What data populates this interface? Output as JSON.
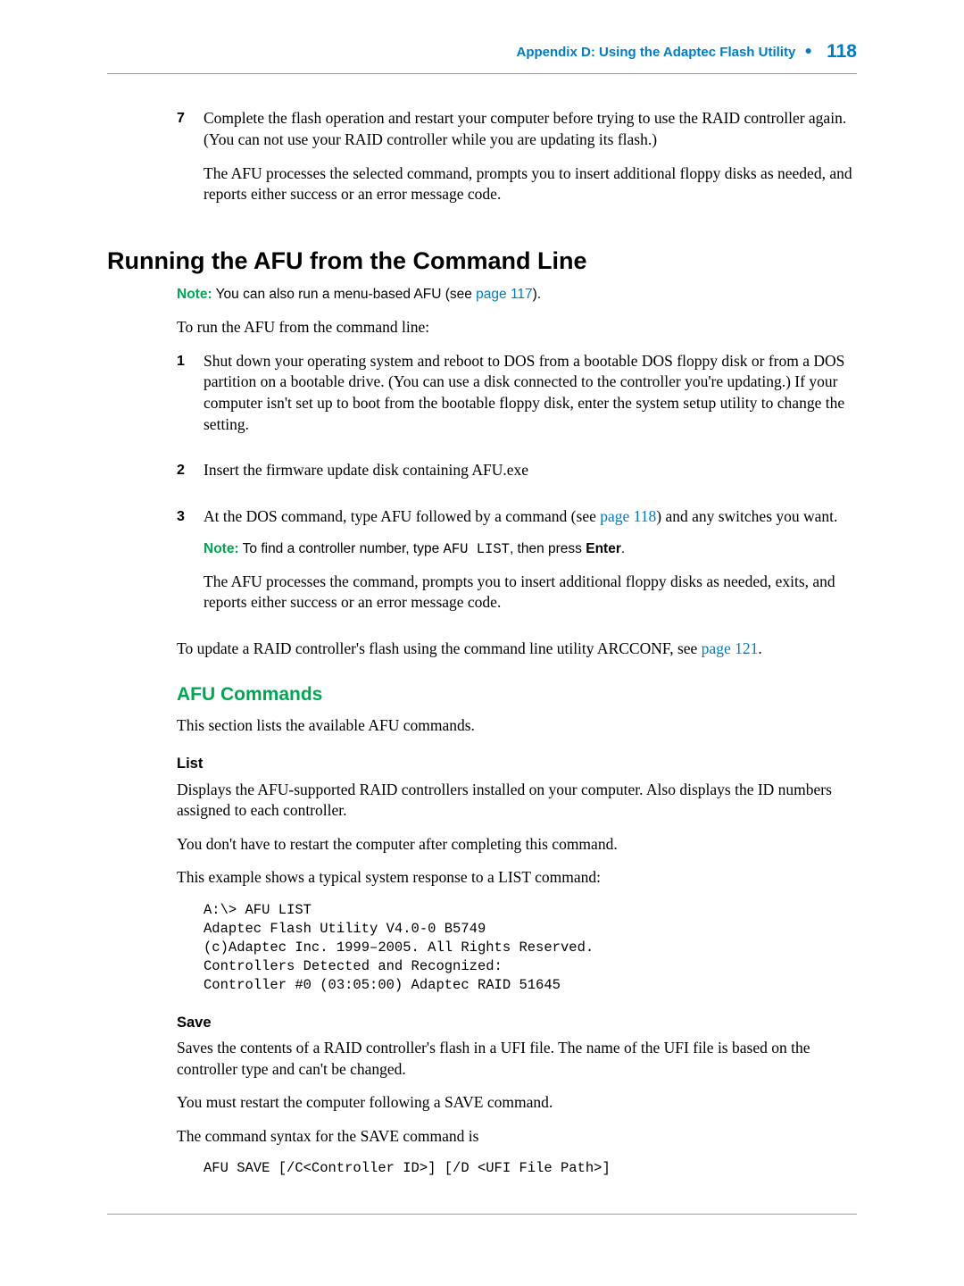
{
  "header": {
    "appendix_label": "Appendix D: Using the Adaptec Flash Utility",
    "bullet": "●",
    "page_number": "118"
  },
  "prior_step": {
    "num": "7",
    "text1": "Complete the flash operation and restart your computer before trying to use the RAID controller again. (You can not use your RAID controller while you are updating its flash.)",
    "text2": "The AFU processes the selected command, prompts you to insert additional floppy disks as needed, and reports either success or an error message code."
  },
  "section1": {
    "title": "Running the AFU from the Command Line",
    "note1_label": "Note:",
    "note1_text": " You can also run a menu-based AFU (see ",
    "note1_linktext": "page 117",
    "note1_after": ").",
    "intro": "To run the AFU from the command line:",
    "steps": [
      {
        "num": "1",
        "text": "Shut down your operating system and reboot to DOS from a bootable DOS floppy disk or from a DOS partition on a bootable drive. (You can use a disk connected to the controller you're updating.) If your computer isn't set up to boot from the bootable floppy disk, enter the system setup utility to change the setting."
      },
      {
        "num": "2",
        "text": "Insert the firmware update disk containing AFU.exe"
      },
      {
        "num": "3",
        "text_before": "At the DOS command, type AFU followed by a command (see ",
        "linktext": "page 118",
        "text_after": ") and any switches you want."
      }
    ],
    "note2_label": "Note:",
    "note2_before": " To find a controller number, type ",
    "note2_code": "AFU LIST",
    "note2_mid": ", then press ",
    "note2_bold": "Enter",
    "note2_end": ".",
    "post1": "The AFU processes the command, prompts you to insert additional floppy disks as needed, exits, and reports either success or an error message code.",
    "post2_before": "To update a RAID controller's flash using the command line utility ARCCONF, see ",
    "post2_linktext": "page 121",
    "post2_after": "."
  },
  "section2": {
    "title": "AFU Commands",
    "intro": "This section lists the available AFU commands.",
    "list": {
      "title": "List",
      "p1": "Displays the AFU-supported RAID controllers installed on your computer. Also displays the ID numbers assigned to each controller.",
      "p2": "You don't have to restart the computer after completing this command.",
      "p3": "This example shows a typical system response to a LIST command:",
      "code": "A:\\> AFU LIST\nAdaptec Flash Utility V4.0-0 B5749\n(c)Adaptec Inc. 1999–2005. All Rights Reserved.\nControllers Detected and Recognized:\nController #0 (03:05:00) Adaptec RAID 51645"
    },
    "save": {
      "title": "Save",
      "p1": "Saves the contents of a RAID controller's flash in a UFI file. The name of the UFI file is based on the controller type and can't be changed.",
      "p2": "You must restart the computer following a SAVE command.",
      "p3": "The command syntax for the SAVE command is",
      "code": "AFU SAVE [/C<Controller ID>] [/D <UFI File Path>]"
    }
  }
}
